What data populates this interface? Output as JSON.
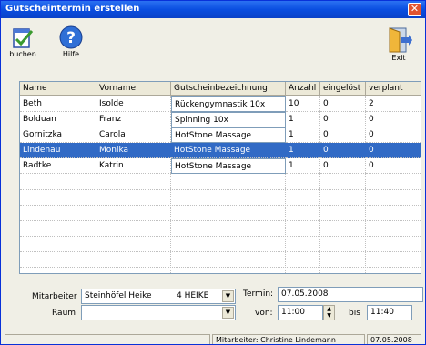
{
  "window": {
    "title": "Gutscheintermin erstellen"
  },
  "toolbar": {
    "buchen_label": "buchen",
    "hilfe_label": "Hilfe",
    "exit_label": "Exit"
  },
  "grid": {
    "headers": [
      "Name",
      "Vorname",
      "Gutscheinbezeichnung",
      "Anzahl",
      "eingelöst",
      "verplant"
    ],
    "rows": [
      [
        "Beth",
        "Isolde",
        "Rückengymnastik 10x",
        "10",
        "0",
        "2"
      ],
      [
        "Bolduan",
        "Franz",
        "Spinning 10x",
        "1",
        "0",
        "0"
      ],
      [
        "Gornitzka",
        "Carola",
        "HotStone Massage",
        "1",
        "0",
        "0"
      ],
      [
        "Lindenau",
        "Monika",
        "HotStone Massage",
        "1",
        "0",
        "0"
      ],
      [
        "Radtke",
        "Katrin",
        "HotStone Massage",
        "1",
        "0",
        "0"
      ]
    ],
    "selected_row_index": 3
  },
  "form": {
    "mitarbeiter_label": "Mitarbeiter",
    "mitarbeiter_value": "Steinhöfel Heike",
    "mitarbeiter_code": "4 HEIKE",
    "raum_label": "Raum",
    "raum_value": "",
    "termin_label": "Termin:",
    "termin_value": "07.05.2008",
    "von_label": "von:",
    "von_value": "11:00",
    "bis_label": "bis",
    "bis_value": "11:40"
  },
  "status": {
    "mitarbeiter": "Mitarbeiter: Christine Lindemann",
    "date": "07.05.2008"
  },
  "colors": {
    "titlebar": "#0a4ee0",
    "selection": "#316ac5",
    "window_bg": "#f0efe6"
  },
  "icons": [
    "check-document-icon",
    "help-icon",
    "exit-door-icon",
    "close-icon"
  ]
}
